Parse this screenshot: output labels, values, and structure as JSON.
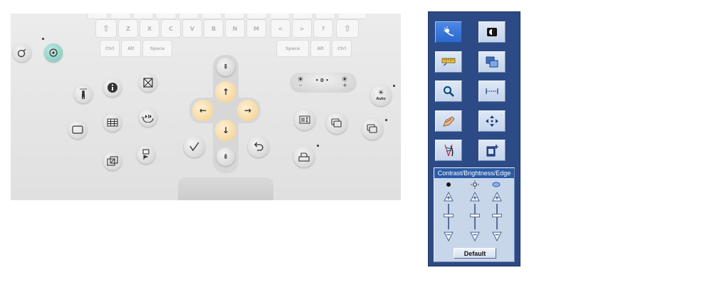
{
  "keyboard": {
    "keys_row1": [
      "⇧",
      "Z",
      "X",
      "C",
      "V",
      "B",
      "N",
      "M",
      "<",
      ">",
      "?",
      "⇧"
    ],
    "keys_row2": [
      "Ctrl",
      "Alt",
      "Space",
      "Space",
      "Alt",
      "Ctrl"
    ],
    "buttons": {
      "auto_label": "Auto",
      "brightness_center": "• 0 •"
    },
    "arrow_icons": {
      "up": "↑",
      "down": "↓",
      "left": "←",
      "right": "→",
      "page_up": "⇞",
      "page_down": "⇟"
    }
  },
  "panel": {
    "contrast_title": "Contrast/Brightness/Edge",
    "default_label": "Default",
    "tools": [
      {
        "name": "brightness-tool",
        "active": true
      },
      {
        "name": "contrast-invert-tool",
        "active": false
      },
      {
        "name": "measure-ruler-tool",
        "active": false
      },
      {
        "name": "copy-image-tool",
        "active": false
      },
      {
        "name": "zoom-tool",
        "active": false
      },
      {
        "name": "distance-tool",
        "active": false
      },
      {
        "name": "annotate-tool",
        "active": false
      },
      {
        "name": "pan-tool",
        "active": false
      },
      {
        "name": "spine-tool",
        "active": false
      },
      {
        "name": "add-page-tool",
        "active": false
      }
    ],
    "colors": {
      "panel_bg": "#2c4a85",
      "active_button": "#3a78dc",
      "title_bar": "#2b5ba6"
    }
  }
}
